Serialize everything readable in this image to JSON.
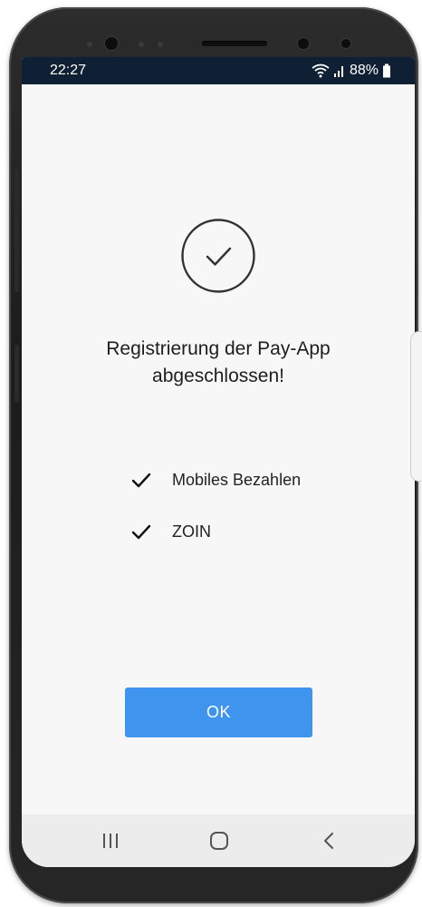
{
  "status_bar": {
    "time": "22:27",
    "battery": "88%",
    "icons": [
      "wifi-icon",
      "signal-icon",
      "battery-icon"
    ]
  },
  "main": {
    "success_icon": "check-circle-icon",
    "title_line1": "Registrierung der Pay-App",
    "title_line2": "abgeschlossen!",
    "items": [
      {
        "label": "Mobiles Bezahlen",
        "icon": "check-icon"
      },
      {
        "label": "ZOIN",
        "icon": "check-icon"
      }
    ],
    "ok_label": "OK"
  },
  "nav_bar": {
    "icons": [
      "recents-icon",
      "home-icon",
      "back-icon"
    ]
  },
  "colors": {
    "accent": "#3f95ee",
    "status_bar_bg": "#0f2035",
    "screen_bg": "#f7f7f7"
  }
}
